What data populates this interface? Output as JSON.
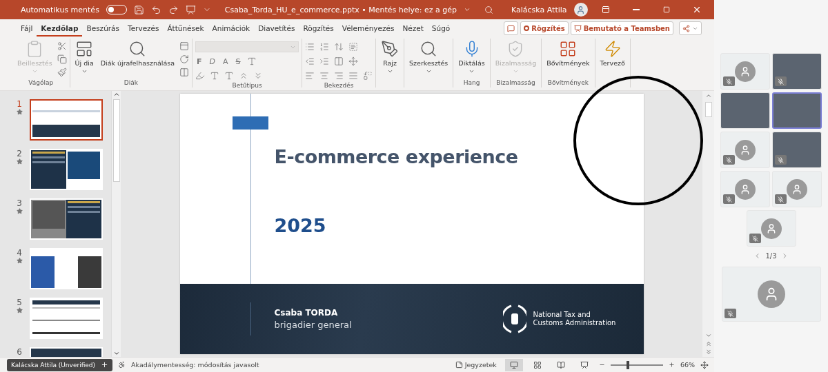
{
  "title_bar": {
    "autosave_label": "Automatikus mentés",
    "autosave_on": false,
    "file_title": "Csaba_Torda_HU_e_commerce.pptx • Mentés helye: ez a gép",
    "user": "Kalácska Attila"
  },
  "tabs": [
    {
      "label": "Fájl",
      "selected": false
    },
    {
      "label": "Kezdőlap",
      "selected": true
    },
    {
      "label": "Beszúrás",
      "selected": false
    },
    {
      "label": "Tervezés",
      "selected": false
    },
    {
      "label": "Áttűnések",
      "selected": false
    },
    {
      "label": "Animációk",
      "selected": false
    },
    {
      "label": "Diavetítés",
      "selected": false
    },
    {
      "label": "Rögzítés",
      "selected": false
    },
    {
      "label": "Véleményezés",
      "selected": false
    },
    {
      "label": "Nézet",
      "selected": false
    },
    {
      "label": "Súgó",
      "selected": false
    }
  ],
  "actions": {
    "record": "Rögzítés",
    "present": "Bemutató a Teamsben"
  },
  "ribbon": {
    "groups": [
      {
        "label": "Vágólap",
        "kind": "clipboard",
        "buttons": [
          {
            "label": "Beillesztés",
            "kind": "paste",
            "menu": true,
            "disabled": true
          }
        ]
      },
      {
        "label": "Diák",
        "kind": "slides",
        "buttons": [
          {
            "label": "Új dia",
            "kind": "new-slide",
            "menu": true,
            "disabled": false
          },
          {
            "label": "Diák újrafelhasználása",
            "kind": "reuse",
            "menu": false,
            "disabled": false
          }
        ]
      },
      {
        "label": "Betűtípus",
        "kind": "font",
        "format_buttons": [
          "F",
          "D",
          "A",
          "S"
        ]
      },
      {
        "label": "Bekezdés",
        "kind": "paragraph"
      },
      {
        "kind": "large",
        "buttons": [
          {
            "label": "Rajz",
            "kind": "draw",
            "menu": true,
            "disabled": false
          }
        ]
      },
      {
        "kind": "large",
        "buttons": [
          {
            "label": "Szerkesztés",
            "kind": "find",
            "menu": true,
            "disabled": false
          }
        ]
      },
      {
        "label": "Hang",
        "kind": "large",
        "buttons": [
          {
            "label": "Diktálás",
            "kind": "dictate",
            "menu": true,
            "disabled": false
          }
        ]
      },
      {
        "label": "Bizalmasság",
        "kind": "large",
        "buttons": [
          {
            "label": "Bizalmasság",
            "kind": "sensitivity",
            "menu": true,
            "disabled": true
          }
        ]
      },
      {
        "label": "Bővítmények",
        "kind": "large",
        "buttons": [
          {
            "label": "Bővítmények",
            "kind": "addins",
            "menu": false,
            "disabled": false
          }
        ]
      },
      {
        "kind": "large",
        "buttons": [
          {
            "label": "Tervező",
            "kind": "designer",
            "menu": false,
            "disabled": false
          }
        ]
      }
    ]
  },
  "thumbnails": [
    {
      "number": "1",
      "selected": true,
      "kind": "title"
    },
    {
      "number": "2",
      "selected": false,
      "kind": "image-right"
    },
    {
      "number": "3",
      "selected": false,
      "kind": "image-left"
    },
    {
      "number": "4",
      "selected": false,
      "kind": "columns"
    },
    {
      "number": "5",
      "selected": false,
      "kind": "diagram"
    },
    {
      "number": "6",
      "selected": false,
      "kind": "dark"
    }
  ],
  "slide": {
    "title": "E-commerce experience",
    "year": "2025",
    "presenter": "Csaba TORDA",
    "role": "brigadier general",
    "organization": "National Tax and Customs Administration"
  },
  "presenter_tag": {
    "name": "Kalácska Attila (Unverified)"
  },
  "status_bar": {
    "accessibility": "Akadálymentesség: módosítás javasolt",
    "notes": "Jegyzetek",
    "views": [
      {
        "kind": "normal",
        "selected": true
      },
      {
        "kind": "sorter",
        "selected": false
      },
      {
        "kind": "reading",
        "selected": false
      },
      {
        "kind": "show",
        "selected": false
      }
    ],
    "zoom": {
      "level": 0.3,
      "reading": "66%"
    }
  },
  "meeting": {
    "tiles": [
      {
        "kind": "avatar",
        "muted": true,
        "active": false
      },
      {
        "kind": "video",
        "muted": true,
        "active": false
      },
      {
        "kind": "video",
        "muted": false,
        "active": false
      },
      {
        "kind": "video",
        "muted": false,
        "active": true
      },
      {
        "kind": "avatar",
        "muted": true,
        "active": false
      },
      {
        "kind": "video",
        "muted": true,
        "active": false
      },
      {
        "kind": "avatar",
        "muted": true,
        "active": false
      },
      {
        "kind": "avatar",
        "muted": true,
        "active": false
      },
      {
        "kind": "avatar",
        "muted": true,
        "active": false
      }
    ],
    "page": "1/3",
    "self_tile": {
      "kind": "avatar",
      "muted": true,
      "active": false
    }
  }
}
